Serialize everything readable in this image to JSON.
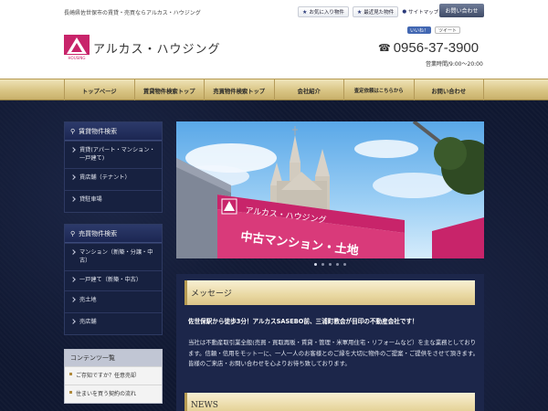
{
  "header": {
    "tagline": "長崎県佐世保市の賃貸・売買ならアルカス・ハウジング",
    "favorites_label": "お気に入り物件",
    "recent_label": "最近見た物件",
    "sitemap_label": "サイトマップ",
    "contact_label": "お問い合わせ",
    "company_name": "アルカス・ハウジング",
    "logo_text": "HOUSING",
    "fb_label": "いいね！",
    "tw_label": "ツイート",
    "phone": "0956-37-3900",
    "hours": "営業時間/9:00～20:00"
  },
  "nav": {
    "items": [
      {
        "label": "トップページ"
      },
      {
        "label": "賃貸物件検索トップ"
      },
      {
        "label": "売買物件検索トップ"
      },
      {
        "label": "会社紹介"
      },
      {
        "label": "査定依頼はこちらから"
      },
      {
        "label": "お問い合わせ"
      }
    ]
  },
  "sidebar": {
    "rental": {
      "title": "賃貸物件検索",
      "items": [
        {
          "label": "賃貸(アパート・マンション・一戸建て)"
        },
        {
          "label": "賃店舗（テナント）"
        },
        {
          "label": "貸駐車場"
        }
      ]
    },
    "sale": {
      "title": "売買物件検索",
      "items": [
        {
          "label": "マンション（新築・分譲・中古）"
        },
        {
          "label": "一戸建て（新築・中古）"
        },
        {
          "label": "売土地"
        },
        {
          "label": "売店舗"
        }
      ]
    },
    "contents": {
      "title": "コンテンツ一覧",
      "items": [
        {
          "label": "ご存知ですか？任意売却"
        },
        {
          "label": "住まいを買う契約の流れ"
        }
      ]
    }
  },
  "hero": {
    "sign_text": "中古マンション・土地",
    "sign_brand": "アルカス・ハウジング"
  },
  "message": {
    "title": "メッセージ",
    "lead": "佐世保駅から徒歩3分！アルカスSASEBO前、三浦町教会が目印の不動産会社です！",
    "body": "当社は不動産取引業全般(売買・買取再販・賃貸・管理・米軍用住宅・リフォームなど）を主な業務としております。信頼・信用をモットーに、一人一人のお客様とのご縁を大切に物件のご提案・ご提供をさせて頂きます。皆様のご来店・お問い合わせを心よりお待ち致しております。"
  },
  "news": {
    "title": "NEWS"
  },
  "colors": {
    "nav_gold": "#d9c585",
    "body_navy": "#0f1730",
    "logo_pink": "#c8246a",
    "accent_blue": "#3f4b67"
  }
}
